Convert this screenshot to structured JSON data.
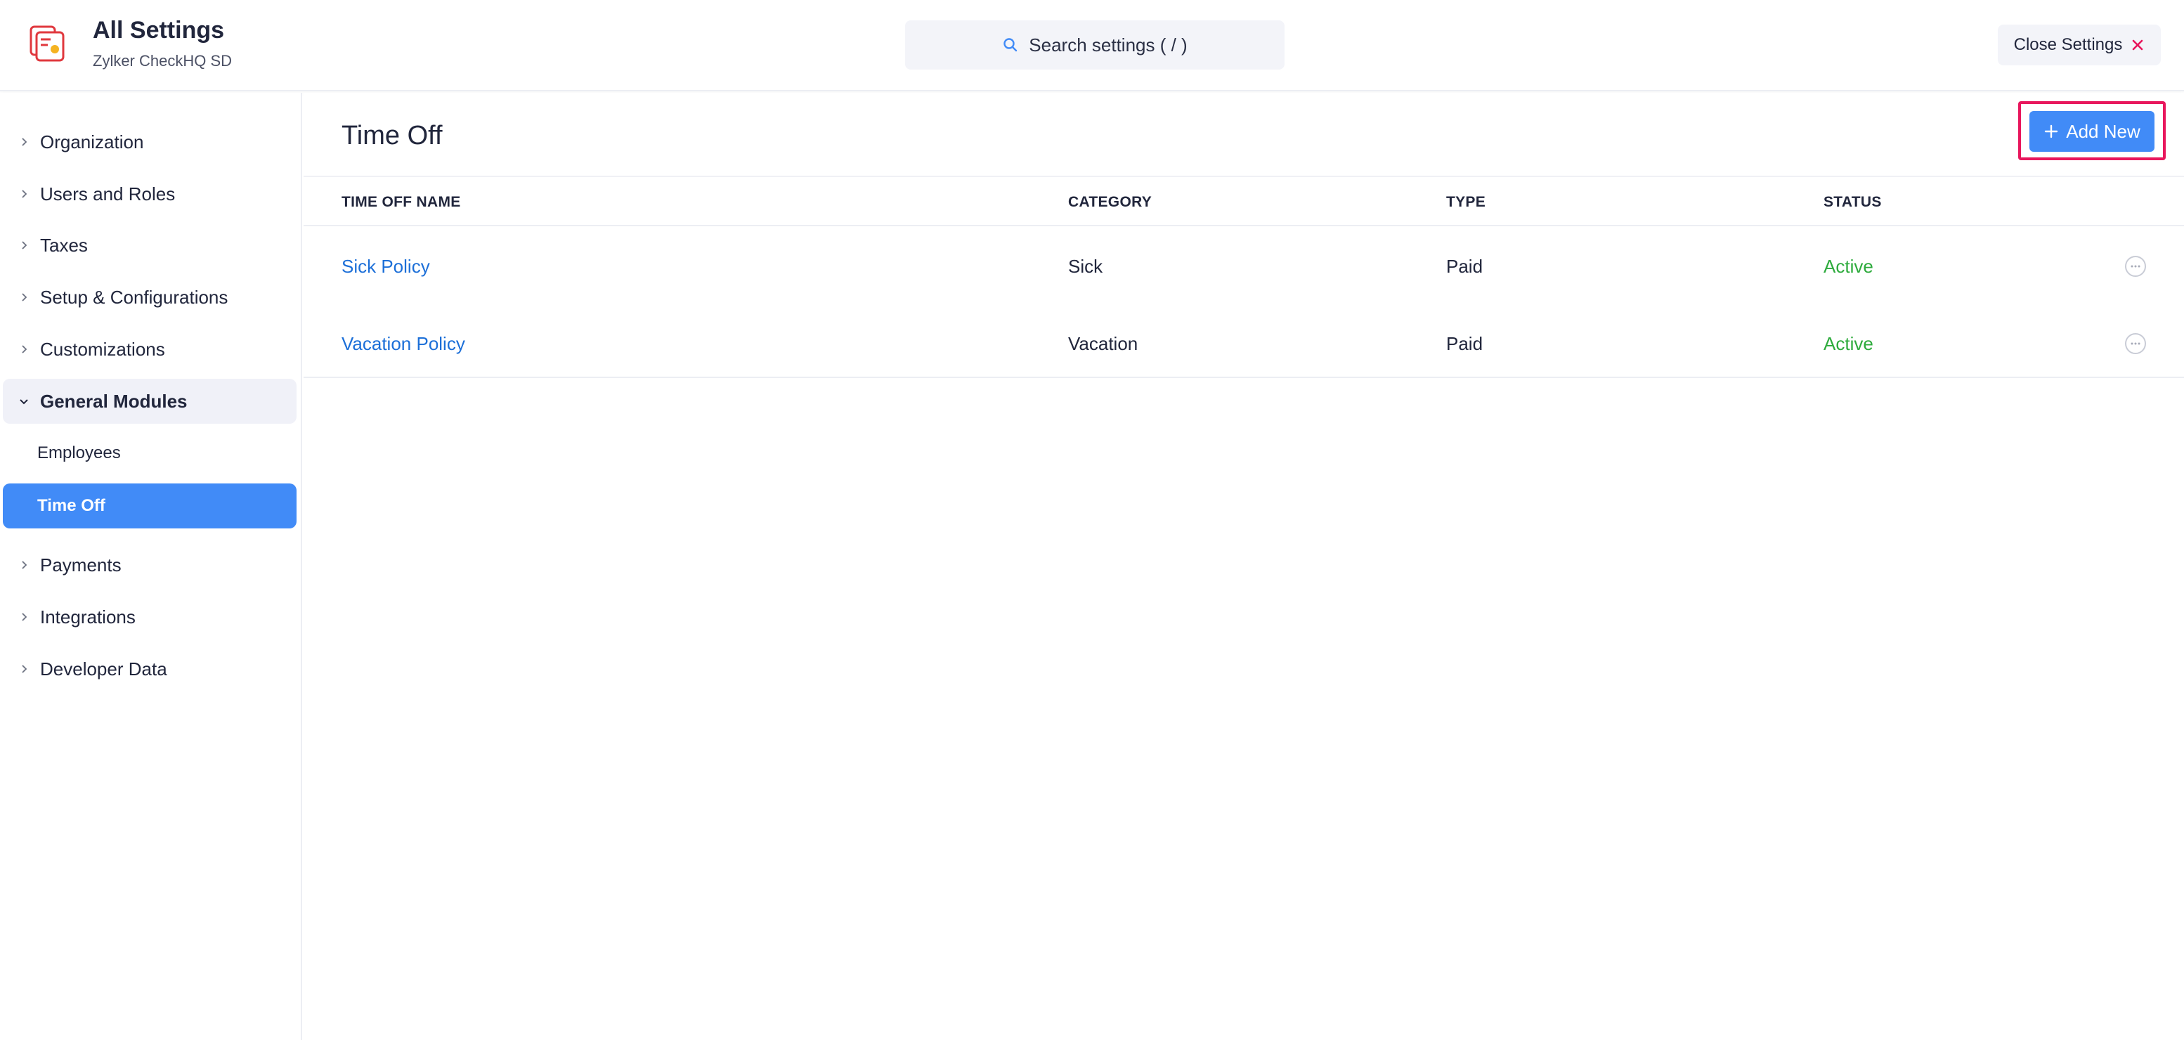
{
  "header": {
    "title": "All Settings",
    "subtitle": "Zylker CheckHQ SD",
    "search_placeholder": "Search settings ( / )",
    "close_label": "Close Settings"
  },
  "sidebar": {
    "items": [
      {
        "label": "Organization"
      },
      {
        "label": "Users and Roles"
      },
      {
        "label": "Taxes"
      },
      {
        "label": "Setup & Configurations"
      },
      {
        "label": "Customizations"
      },
      {
        "label": "General Modules",
        "expanded": true
      },
      {
        "label": "Payments"
      },
      {
        "label": "Integrations"
      },
      {
        "label": "Developer Data"
      }
    ],
    "sub_items": [
      {
        "label": "Employees"
      },
      {
        "label": "Time Off",
        "active": true
      }
    ]
  },
  "main": {
    "title": "Time Off",
    "add_label": "Add New",
    "columns": [
      "TIME OFF NAME",
      "CATEGORY",
      "TYPE",
      "STATUS"
    ],
    "rows": [
      {
        "name": "Sick Policy",
        "category": "Sick",
        "type": "Paid",
        "status": "Active"
      },
      {
        "name": "Vacation Policy",
        "category": "Vacation",
        "type": "Paid",
        "status": "Active"
      }
    ]
  },
  "colors": {
    "accent": "#418bf7",
    "link": "#1c6fd8",
    "status_active": "#2eab3d",
    "highlight": "#e8175d"
  },
  "icons": {
    "logo": "settings-app-logo",
    "search": "search-icon",
    "close": "close-icon",
    "add": "plus-icon",
    "row_menu": "more-options-icon",
    "chevron_right": "chevron-right-icon",
    "chevron_down": "chevron-down-icon"
  }
}
